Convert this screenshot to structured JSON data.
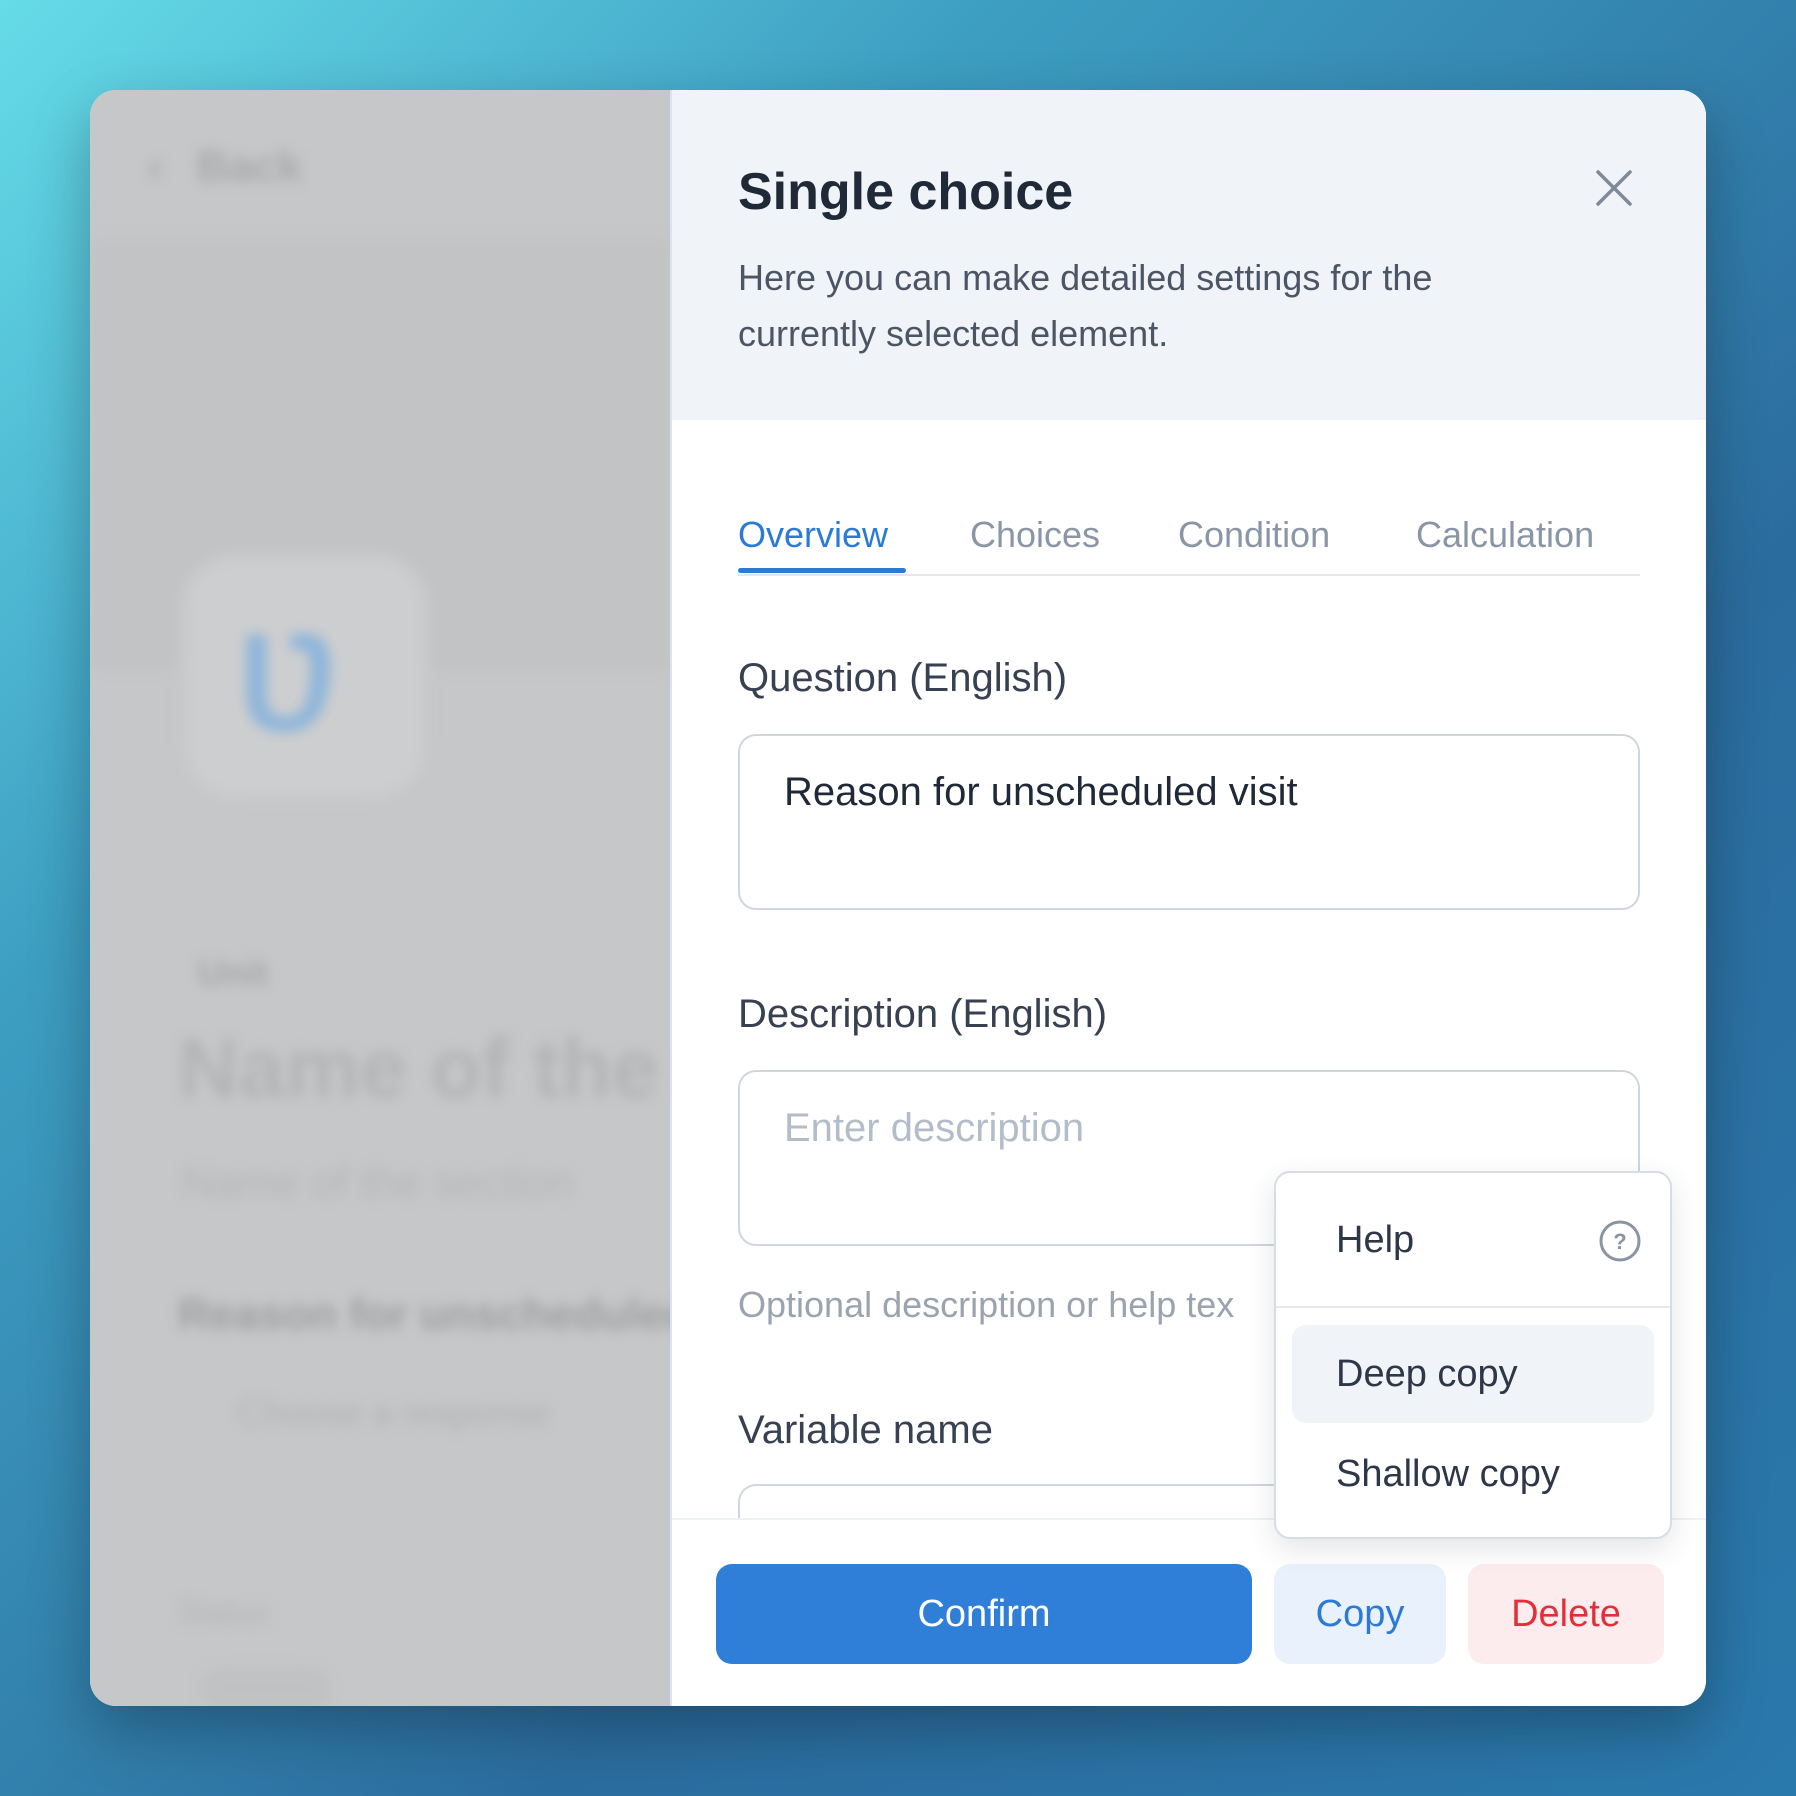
{
  "background_app": {
    "back_label": "Back",
    "card_glyph": "Ʋ",
    "label": "Unit",
    "title": "Name of the",
    "subtitle": "Name of the section",
    "question": "Reason for unscheduled",
    "option": "Choose a response",
    "small_label": "Status"
  },
  "panel": {
    "title": "Single choice",
    "description": "Here you can make detailed settings for the currently selected element.",
    "close_icon": "close-icon"
  },
  "tabs": [
    {
      "label": "Overview",
      "active": true
    },
    {
      "label": "Choices",
      "active": false
    },
    {
      "label": "Condition",
      "active": false
    },
    {
      "label": "Calculation",
      "active": false
    }
  ],
  "fields": {
    "question": {
      "label": "Question (English)",
      "value": "Reason for unscheduled visit"
    },
    "description": {
      "label": "Description (English)",
      "placeholder": "Enter description",
      "helper": "Optional description or help tex"
    },
    "variable": {
      "label": "Variable name"
    }
  },
  "footer": {
    "confirm_label": "Confirm",
    "copy_label": "Copy",
    "delete_label": "Delete"
  },
  "copy_menu": {
    "items": [
      {
        "label": "Help",
        "icon": "help-circle-icon"
      },
      {
        "label": "Deep copy",
        "highlighted": true
      },
      {
        "label": "Shallow copy"
      }
    ]
  },
  "colors": {
    "accent": "#2b7bd6",
    "danger": "#e0313a",
    "header_bg": "#f0f4f9"
  }
}
